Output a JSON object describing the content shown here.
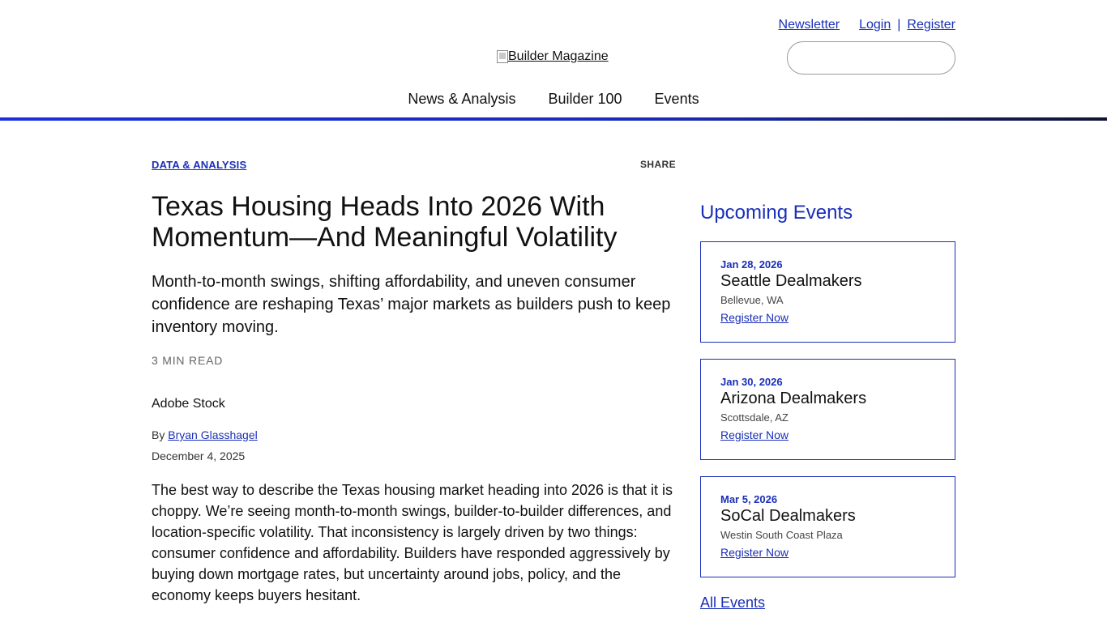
{
  "header": {
    "utility_links": {
      "newsletter": "Newsletter",
      "login": "Login",
      "separator": "|",
      "register": "Register"
    },
    "logo_alt": "Builder Magazine",
    "nav": [
      "News & Analysis",
      "Builder 100",
      "Events"
    ]
  },
  "article": {
    "category": "DATA & ANALYSIS",
    "share_label": "SHARE",
    "title": "Texas Housing Heads Into 2026 With Momentum—And Meaningful Volatility",
    "dek": "Month-to-month swings, shifting affordability, and uneven consumer confidence are reshaping Texas’ major markets as builders push to keep inventory moving.",
    "read_time": "3 MIN READ",
    "image_credit": "Adobe Stock",
    "byline_prefix": "By",
    "author": "Bryan Glasshagel",
    "date": "December 4, 2025",
    "body": "The best way to describe the Texas housing market heading into 2026 is that it is choppy. We’re seeing month-to-month swings, builder-to-builder differences, and location-specific volatility. That inconsistency is largely driven by two things: consumer confidence and affordability. Builders have responded aggressively by buying down mortgage rates, but uncertainty around jobs, policy, and the economy keeps buyers hesitant."
  },
  "sidebar": {
    "title": "Upcoming Events",
    "events": [
      {
        "date": "Jan 28, 2026",
        "name": "Seattle Dealmakers",
        "location": "Bellevue, WA",
        "cta": "Register Now"
      },
      {
        "date": "Jan 30, 2026",
        "name": "Arizona Dealmakers",
        "location": "Scottsdale, AZ",
        "cta": "Register Now"
      },
      {
        "date": "Mar 5, 2026",
        "name": "SoCal Dealmakers",
        "location": "Westin South Coast Plaza",
        "cta": "Register Now"
      }
    ],
    "all_events": "All Events"
  },
  "colors": {
    "accent": "#1a2fb8",
    "text": "#111111",
    "muted": "#666666"
  }
}
